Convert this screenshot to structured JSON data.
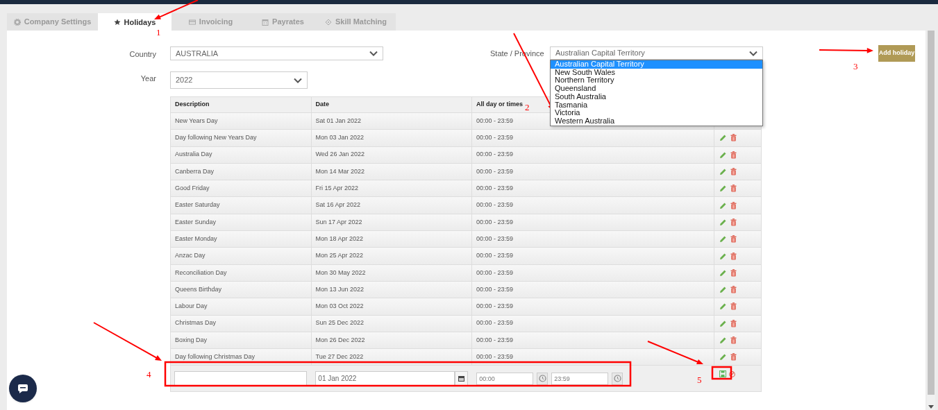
{
  "tabs": [
    {
      "label": "Company Settings",
      "selected": false
    },
    {
      "label": "Holidays",
      "selected": true
    },
    {
      "label": "Invoicing",
      "selected": false
    },
    {
      "label": "Payrates",
      "selected": false
    },
    {
      "label": "Skill Matching",
      "selected": false
    }
  ],
  "form": {
    "country_label": "Country",
    "country": "AUSTRALIA",
    "year_label": "Year",
    "year": "2022",
    "state_label": "State / Province",
    "state": "Australian Capital Territory",
    "state_options": [
      {
        "label": "Australian Capital Territory",
        "selected": true
      },
      {
        "label": "New South Wales",
        "selected": false
      },
      {
        "label": "Northern Territory",
        "selected": false
      },
      {
        "label": "Queensland",
        "selected": false
      },
      {
        "label": "South Australia",
        "selected": false
      },
      {
        "label": "Tasmania",
        "selected": false
      },
      {
        "label": "Victoria",
        "selected": false
      },
      {
        "label": "Western Australia",
        "selected": false
      }
    ]
  },
  "add_button": "Add holiday",
  "table": {
    "columns": [
      "Description",
      "Date",
      "All day or times"
    ],
    "rows": [
      {
        "description": "New Years Day",
        "date": "Sat 01 Jan 2022",
        "times": "00:00 - 23:59"
      },
      {
        "description": "Day following New Years Day",
        "date": "Mon 03 Jan 2022",
        "times": "00:00 - 23:59",
        "actions": true
      },
      {
        "description": "Australia Day",
        "date": "Wed 26 Jan 2022",
        "times": "00:00 - 23:59",
        "actions": true
      },
      {
        "description": "Canberra Day",
        "date": "Mon 14 Mar 2022",
        "times": "00:00 - 23:59",
        "actions": true
      },
      {
        "description": "Good Friday",
        "date": "Fri 15 Apr 2022",
        "times": "00:00 - 23:59",
        "actions": true
      },
      {
        "description": "Easter Saturday",
        "date": "Sat 16 Apr 2022",
        "times": "00:00 - 23:59",
        "actions": true
      },
      {
        "description": "Easter Sunday",
        "date": "Sun 17 Apr 2022",
        "times": "00:00 - 23:59",
        "actions": true
      },
      {
        "description": "Easter Monday",
        "date": "Mon 18 Apr 2022",
        "times": "00:00 - 23:59",
        "actions": true
      },
      {
        "description": "Anzac Day",
        "date": "Mon 25 Apr 2022",
        "times": "00:00 - 23:59",
        "actions": true
      },
      {
        "description": "Reconciliation Day",
        "date": "Mon 30 May 2022",
        "times": "00:00 - 23:59",
        "actions": true
      },
      {
        "description": "Queens Birthday",
        "date": "Mon 13 Jun 2022",
        "times": "00:00 - 23:59",
        "actions": true
      },
      {
        "description": "Labour Day",
        "date": "Mon 03 Oct 2022",
        "times": "00:00 - 23:59",
        "actions": true
      },
      {
        "description": "Christmas Day",
        "date": "Sun 25 Dec 2022",
        "times": "00:00 - 23:59",
        "actions": true
      },
      {
        "description": "Boxing Day",
        "date": "Mon 26 Dec 2022",
        "times": "00:00 - 23:59",
        "actions": true
      },
      {
        "description": "Day following Christmas Day",
        "date": "Tue 27 Dec 2022",
        "times": "00:00 - 23:59",
        "actions": true
      }
    ]
  },
  "new_row": {
    "date": "01 Jan 2022",
    "start": "00:00",
    "end": "23:59"
  },
  "annotations": [
    "1",
    "2",
    "3",
    "4",
    "5"
  ]
}
